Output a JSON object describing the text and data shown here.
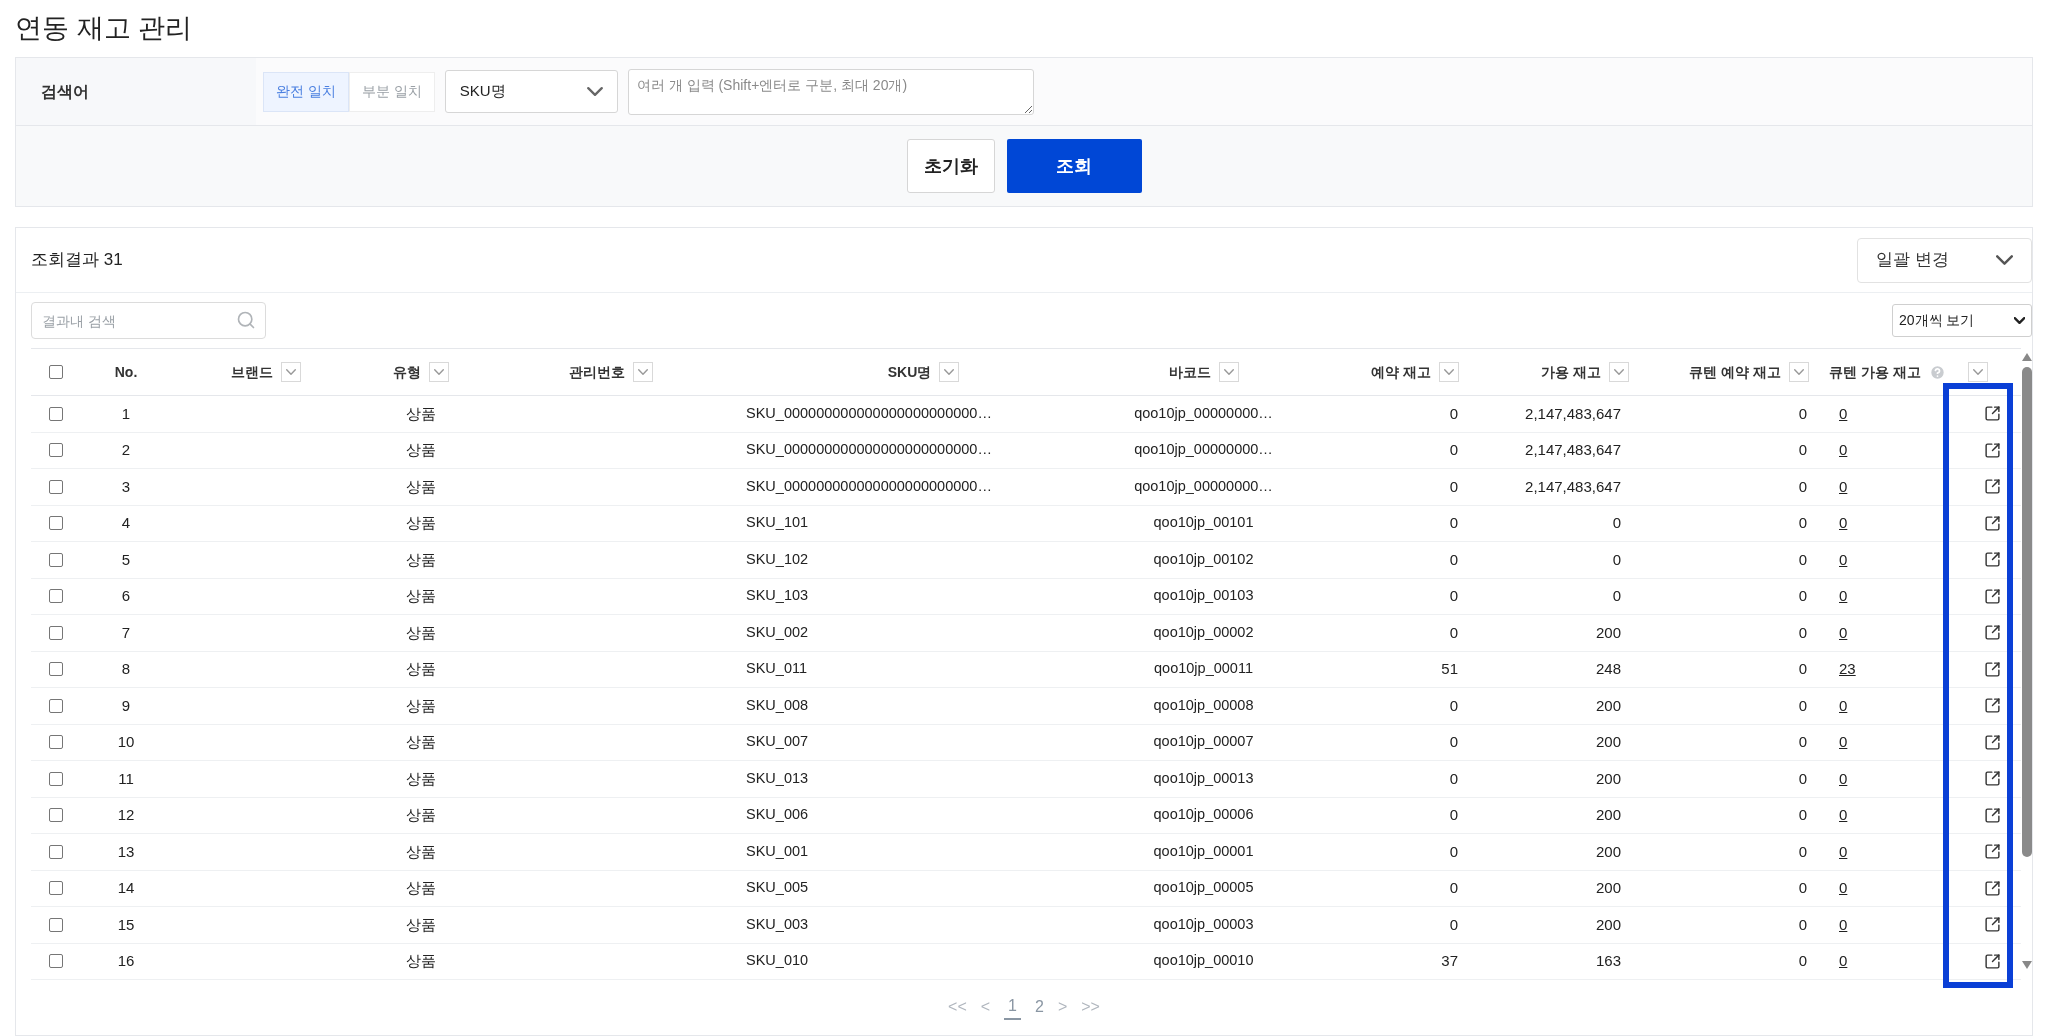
{
  "page_title": "연동 재고 관리",
  "search": {
    "label": "검색어",
    "match_modes": [
      {
        "label": "완전 일치",
        "selected": true
      },
      {
        "label": "부분 일치",
        "selected": false
      }
    ],
    "field_select": "SKU명",
    "placeholder": "여러 개 입력 (Shift+엔터로 구분, 최대 20개)",
    "buttons": [
      {
        "label": "초기화",
        "kind": "secondary"
      },
      {
        "label": "조회",
        "kind": "primary"
      }
    ]
  },
  "results": {
    "title": "조회결과 31",
    "bulk_change": "일괄 변경",
    "filter_placeholder": "결과내 검색",
    "page_size": "20개씩 보기"
  },
  "table": {
    "header_checkbox": {
      "checked": false
    },
    "columns": [
      {
        "label": "No.",
        "kind": "plain"
      },
      {
        "label": "브랜드",
        "kind": "filter"
      },
      {
        "label": "유형",
        "kind": "filter"
      },
      {
        "label": "관리번호",
        "kind": "filter"
      },
      {
        "label": "SKU명",
        "kind": "filter"
      },
      {
        "label": "바코드",
        "kind": "filter"
      },
      {
        "label": "예약 재고",
        "kind": "filter"
      },
      {
        "label": "가용 재고",
        "kind": "filter"
      },
      {
        "label": "큐텐 예약 재고",
        "kind": "filter"
      },
      {
        "label": "큐텐 가용 재고",
        "kind": "filter_help"
      }
    ],
    "rows": [
      {
        "selected": false,
        "no": "1",
        "type": "상품",
        "sku": "SKU_000000000000000000000000…",
        "barcode": "qoo10jp_00000000…",
        "reserved": "0",
        "available": "2,147,483,647",
        "qten_reserved": "0",
        "qten_available": "0"
      },
      {
        "selected": false,
        "no": "2",
        "type": "상품",
        "sku": "SKU_000000000000000000000000…",
        "barcode": "qoo10jp_00000000…",
        "reserved": "0",
        "available": "2,147,483,647",
        "qten_reserved": "0",
        "qten_available": "0"
      },
      {
        "selected": false,
        "no": "3",
        "type": "상품",
        "sku": "SKU_000000000000000000000000…",
        "barcode": "qoo10jp_00000000…",
        "reserved": "0",
        "available": "2,147,483,647",
        "qten_reserved": "0",
        "qten_available": "0"
      },
      {
        "selected": false,
        "no": "4",
        "type": "상품",
        "sku": "SKU_101",
        "barcode": "qoo10jp_00101",
        "reserved": "0",
        "available": "0",
        "qten_reserved": "0",
        "qten_available": "0"
      },
      {
        "selected": false,
        "no": "5",
        "type": "상품",
        "sku": "SKU_102",
        "barcode": "qoo10jp_00102",
        "reserved": "0",
        "available": "0",
        "qten_reserved": "0",
        "qten_available": "0"
      },
      {
        "selected": false,
        "no": "6",
        "type": "상품",
        "sku": "SKU_103",
        "barcode": "qoo10jp_00103",
        "reserved": "0",
        "available": "0",
        "qten_reserved": "0",
        "qten_available": "0"
      },
      {
        "selected": false,
        "no": "7",
        "type": "상품",
        "sku": "SKU_002",
        "barcode": "qoo10jp_00002",
        "reserved": "0",
        "available": "200",
        "qten_reserved": "0",
        "qten_available": "0"
      },
      {
        "selected": false,
        "no": "8",
        "type": "상품",
        "sku": "SKU_011",
        "barcode": "qoo10jp_00011",
        "reserved": "51",
        "available": "248",
        "qten_reserved": "0",
        "qten_available": "23"
      },
      {
        "selected": false,
        "no": "9",
        "type": "상품",
        "sku": "SKU_008",
        "barcode": "qoo10jp_00008",
        "reserved": "0",
        "available": "200",
        "qten_reserved": "0",
        "qten_available": "0"
      },
      {
        "selected": false,
        "no": "10",
        "type": "상품",
        "sku": "SKU_007",
        "barcode": "qoo10jp_00007",
        "reserved": "0",
        "available": "200",
        "qten_reserved": "0",
        "qten_available": "0"
      },
      {
        "selected": false,
        "no": "11",
        "type": "상품",
        "sku": "SKU_013",
        "barcode": "qoo10jp_00013",
        "reserved": "0",
        "available": "200",
        "qten_reserved": "0",
        "qten_available": "0"
      },
      {
        "selected": false,
        "no": "12",
        "type": "상품",
        "sku": "SKU_006",
        "barcode": "qoo10jp_00006",
        "reserved": "0",
        "available": "200",
        "qten_reserved": "0",
        "qten_available": "0"
      },
      {
        "selected": false,
        "no": "13",
        "type": "상품",
        "sku": "SKU_001",
        "barcode": "qoo10jp_00001",
        "reserved": "0",
        "available": "200",
        "qten_reserved": "0",
        "qten_available": "0"
      },
      {
        "selected": false,
        "no": "14",
        "type": "상품",
        "sku": "SKU_005",
        "barcode": "qoo10jp_00005",
        "reserved": "0",
        "available": "200",
        "qten_reserved": "0",
        "qten_available": "0"
      },
      {
        "selected": false,
        "no": "15",
        "type": "상품",
        "sku": "SKU_003",
        "barcode": "qoo10jp_00003",
        "reserved": "0",
        "available": "200",
        "qten_reserved": "0",
        "qten_available": "0"
      },
      {
        "selected": false,
        "no": "16",
        "type": "상품",
        "sku": "SKU_010",
        "barcode": "qoo10jp_00010",
        "reserved": "37",
        "available": "163",
        "qten_reserved": "0",
        "qten_available": "0"
      }
    ]
  },
  "pagination": {
    "first": "<<",
    "prev": "<",
    "pages": [
      {
        "label": "1",
        "selected": true
      },
      {
        "label": "2",
        "selected": false
      }
    ],
    "next": ">",
    "last": ">>"
  }
}
